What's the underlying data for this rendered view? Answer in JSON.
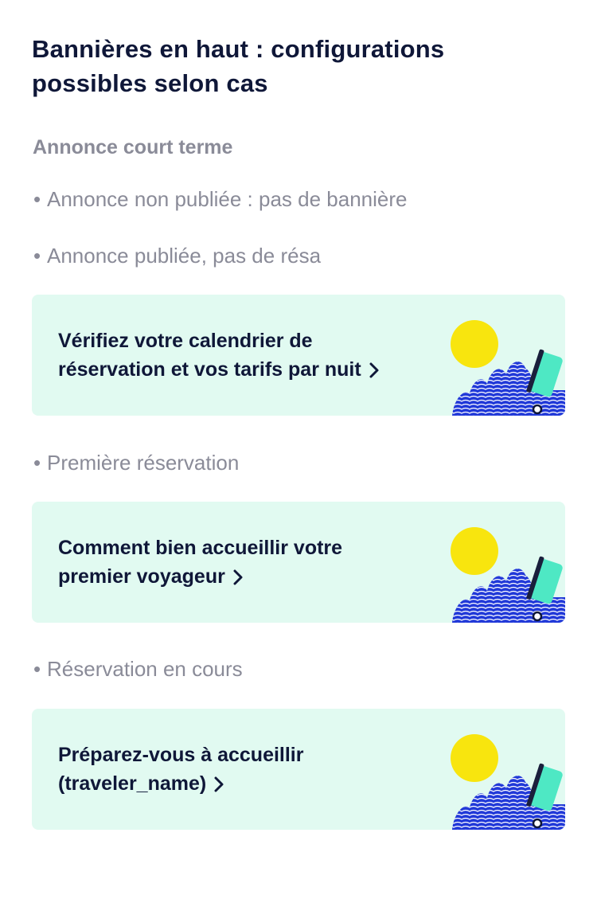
{
  "page": {
    "title": "Bannières en haut : configurations possibles selon cas",
    "section_label": "Annonce court terme"
  },
  "cases": [
    {
      "bullet": "•",
      "label": "Annonce non publiée : pas de bannière"
    },
    {
      "bullet": "•",
      "label": "Annonce publiée, pas de résa"
    },
    {
      "bullet": "•",
      "label": "Première réservation"
    },
    {
      "bullet": "•",
      "label": "Réservation en cours"
    }
  ],
  "banners": [
    {
      "line1": "Vérifiez votre calendrier de",
      "line2": "réservation et vos tarifs par nuit"
    },
    {
      "line1": "Comment bien accueillir votre",
      "line2": "premier voyageur"
    },
    {
      "line1": "Préparez-vous à accueillir",
      "line2": "(traveler_name)"
    }
  ],
  "colors": {
    "banner_bg": "#e1faf1",
    "sun": "#f8e50e",
    "wave": "#2139d8",
    "suitcase": "#4ee8c4",
    "title": "#0f1738",
    "muted": "#8a8b98"
  },
  "icons": {
    "chevron": "chevron-right-icon",
    "illustration": "beach-travel-illustration"
  }
}
